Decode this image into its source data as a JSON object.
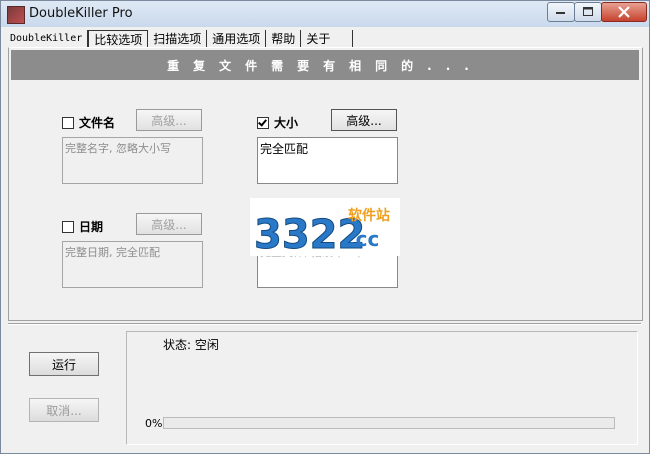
{
  "window": {
    "title": "DoubleKiller Pro"
  },
  "tabs": [
    {
      "label": "DoubleKiller"
    },
    {
      "label": "比较选项"
    },
    {
      "label": "扫描选项"
    },
    {
      "label": "通用选项"
    },
    {
      "label": "帮助"
    },
    {
      "label": "关于"
    }
  ],
  "banner": {
    "text": "重复文件需要有相同的..."
  },
  "options": {
    "filename": {
      "label": "文件名",
      "checked": false,
      "advanced": "高级...",
      "detail": "完整名字, 忽略大小写"
    },
    "size": {
      "label": "大小",
      "checked": true,
      "advanced": "高级...",
      "detail": "完全匹配"
    },
    "date": {
      "label": "日期",
      "checked": false,
      "advanced": "高级...",
      "detail": "完整日期, 完全匹配"
    },
    "content": {
      "detail": "完整文件, 指纹 (crc)"
    }
  },
  "watermark": {
    "text": "3322.cc",
    "sub": "软件站",
    "color_main": "#2a78c8",
    "color_accent": "#f0a020"
  },
  "controls": {
    "run": "运行",
    "cancel": "取消..."
  },
  "status": {
    "label": "状态:",
    "value": "空闲"
  },
  "progress": {
    "percent_text": "0%",
    "value": 0,
    "color": "#3cb043"
  }
}
